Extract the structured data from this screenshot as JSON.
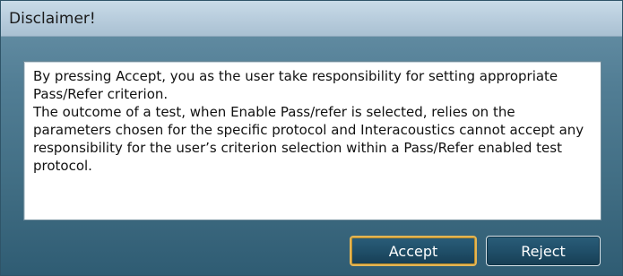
{
  "window": {
    "title": "Disclaimer!"
  },
  "message": {
    "text": "By pressing Accept, you as the user take responsibility for setting appropriate Pass/Refer criterion.\nThe outcome of a test, when Enable Pass/refer is selected, relies on the parameters chosen for the specific protocol and Interacoustics cannot accept any responsibility for the user’s criterion selection within a Pass/Refer enabled test protocol."
  },
  "buttons": {
    "accept_label": "Accept",
    "reject_label": "Reject"
  },
  "colors": {
    "accent_border": "#e4b553",
    "button_fill": "#1f4d67",
    "dialog_background": "#4a778e",
    "titlebar": "#b7ccdc"
  }
}
